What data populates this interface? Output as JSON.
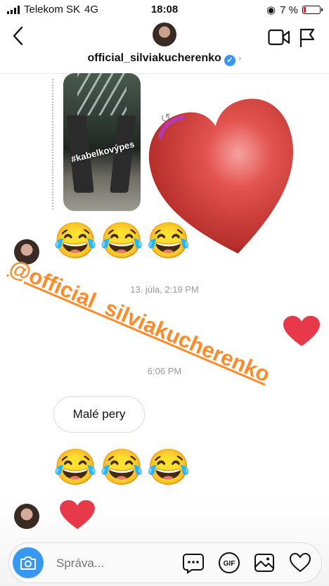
{
  "status_bar": {
    "carrier": "Telekom SK",
    "network": "4G",
    "time": "18:08",
    "battery_percent": "7 %",
    "battery_level": 0.07
  },
  "header": {
    "username": "official_silviakucherenko",
    "verified_mark": "✓",
    "chevron": "›",
    "icons": [
      "back-arrow-icon",
      "video-camera-icon",
      "flag-icon"
    ]
  },
  "conversation": {
    "story_tag": "#kabelkovýpes",
    "reshare_icon": "↺",
    "reaction_row_1": "😂😂😂",
    "timestamp_1": "13. júla, 2:19 PM",
    "timestamp_2": "6:06 PM",
    "message_1": "Malé pery",
    "reaction_row_2": "😂😂😂",
    "heart_color": "#e8394a"
  },
  "sticker_mention": "@official_silviakucherenko",
  "composer": {
    "placeholder": "Správa...",
    "icons": [
      "camera-icon",
      "more-dots-icon",
      "gif-icon",
      "gallery-icon",
      "heart-icon"
    ],
    "accent": "#3897f0"
  }
}
